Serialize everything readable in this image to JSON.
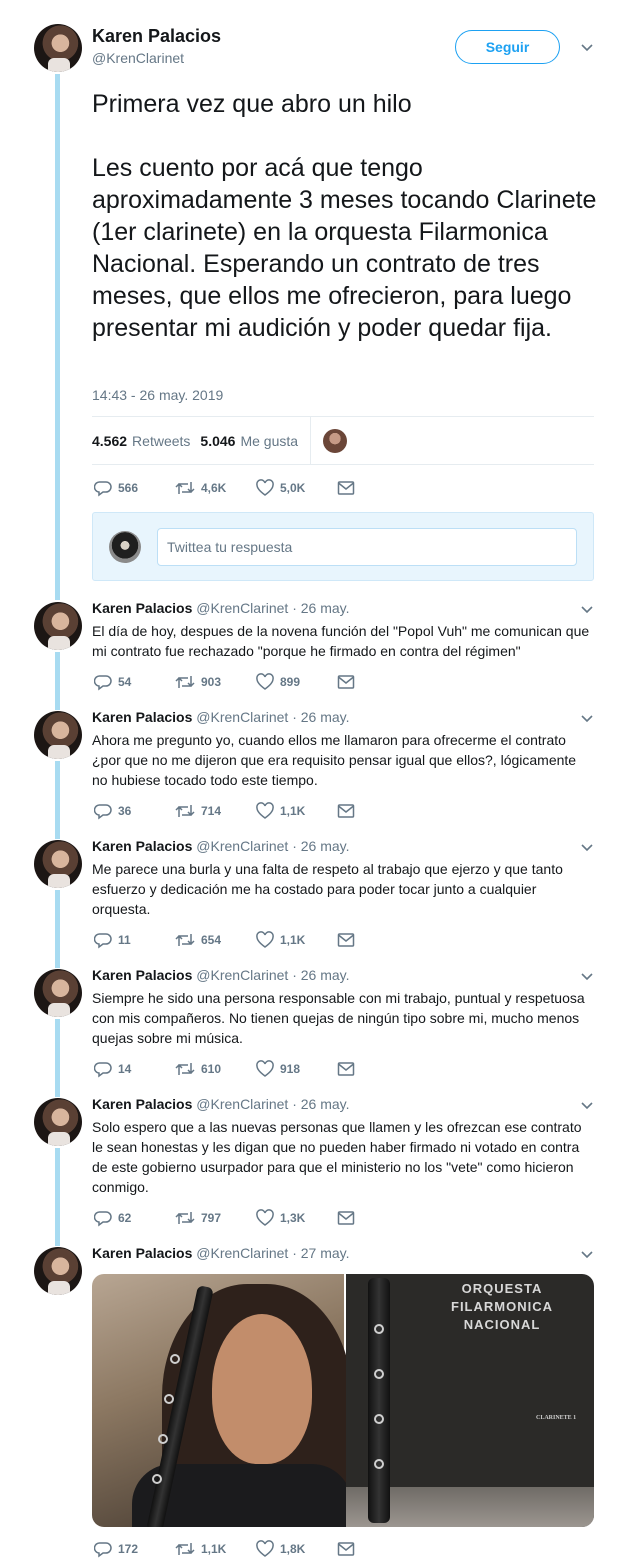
{
  "main_tweet": {
    "author_name": "Karen Palacios",
    "author_handle": "@KrenClarinet",
    "follow_label": "Seguir",
    "text": "Primera vez que abro un hilo\n\nLes cuento por acá que tengo aproximadamente 3 meses tocando Clarinete (1er clarinete) en la orquesta Filarmonica Nacional. Esperando un contrato de tres meses, que ellos me ofrecieron, para luego presentar mi audición y poder quedar fija.",
    "timestamp": "14:43 - 26 may. 2019",
    "retweets_count": "4.562",
    "retweets_label": "Retweets",
    "likes_count": "5.046",
    "likes_label": "Me gusta",
    "actions": {
      "replies": "566",
      "retweets": "4,6K",
      "likes": "5,0K"
    }
  },
  "reply_box": {
    "placeholder": "Twittea tu respuesta"
  },
  "thread": [
    {
      "name": "Karen Palacios",
      "handle": "@KrenClarinet",
      "date": "· 26 may.",
      "text": "El día de hoy, despues de la novena función del \"Popol Vuh\" me comunican que mi contrato fue rechazado \"porque he firmado en contra del régimen\"",
      "replies": "54",
      "retweets": "903",
      "likes": "899"
    },
    {
      "name": "Karen Palacios",
      "handle": "@KrenClarinet",
      "date": "· 26 may.",
      "text": "Ahora me pregunto yo, cuando ellos me llamaron para ofrecerme el contrato ¿por que no me dijeron que era requisito pensar igual que ellos?, lógicamente no hubiese tocado todo este tiempo.",
      "replies": "36",
      "retweets": "714",
      "likes": "1,1K"
    },
    {
      "name": "Karen Palacios",
      "handle": "@KrenClarinet",
      "date": "· 26 may.",
      "text": "Me parece una burla y una falta de respeto al trabajo que ejerzo y que tanto esfuerzo y dedicación me ha costado para poder tocar junto a cualquier orquesta.",
      "replies": "11",
      "retweets": "654",
      "likes": "1,1K"
    },
    {
      "name": "Karen Palacios",
      "handle": "@KrenClarinet",
      "date": "· 26 may.",
      "text": "Siempre he sido una persona responsable con mi trabajo, puntual y respetuosa con mis compañeros. No tienen quejas de ningún tipo sobre mi, mucho menos quejas sobre mi música.",
      "replies": "14",
      "retweets": "610",
      "likes": "918"
    },
    {
      "name": "Karen Palacios",
      "handle": "@KrenClarinet",
      "date": "· 26 may.",
      "text": "Solo espero que a las nuevas personas que llamen y les ofrezcan ese contrato le sean honestas y les digan que no pueden haber firmado ni votado en contra de este gobierno usurpador para que el ministerio no los \"vete\" como hicieron conmigo.",
      "replies": "62",
      "retweets": "797",
      "likes": "1,3K"
    },
    {
      "name": "Karen Palacios",
      "handle": "@KrenClarinet",
      "date": "· 27 may.",
      "text": "",
      "replies": "172",
      "retweets": "1,1K",
      "likes": "1,8K",
      "media": {
        "cover_title_line1": "ORQUESTA FILARMONICA",
        "cover_title_line2": "NACIONAL",
        "cover_label": "CLARINETE 1"
      }
    }
  ],
  "icons": {
    "reply": "reply-icon",
    "retweet": "retweet-icon",
    "like": "heart-icon",
    "dm": "envelope-icon",
    "menu": "chevron-down-icon"
  },
  "colors": {
    "accent": "#1da1f2",
    "thread_line": "#a8dbf1",
    "muted": "#657786"
  }
}
